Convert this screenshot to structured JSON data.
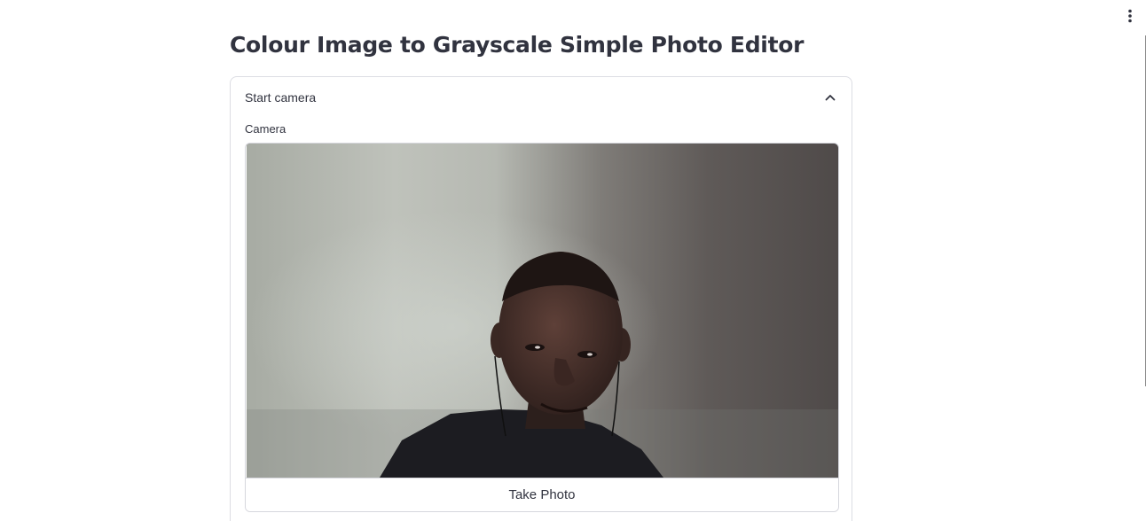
{
  "header": {
    "menu_icon": "vertical-ellipsis-icon"
  },
  "page": {
    "title": "Colour Image to Grayscale Simple Photo Editor"
  },
  "expander": {
    "label": "Start camera",
    "state_icon": "chevron-up-icon"
  },
  "camera": {
    "label": "Camera",
    "take_photo_label": "Take Photo"
  }
}
